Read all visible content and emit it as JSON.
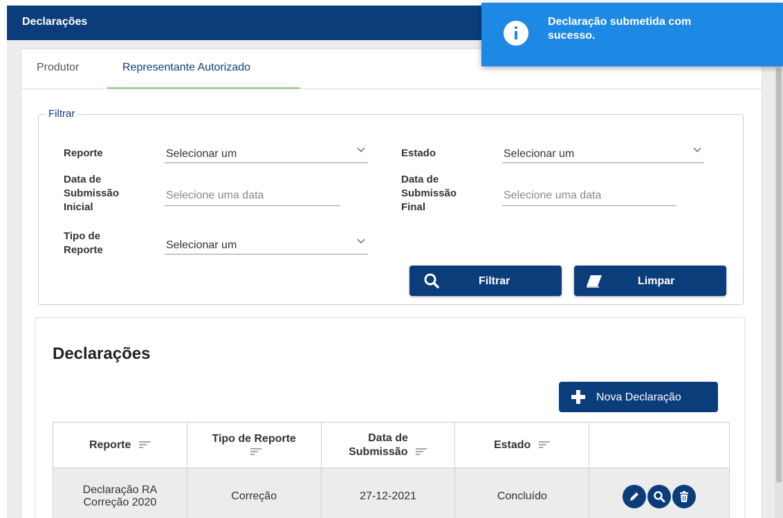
{
  "app": {
    "title": "Declarações"
  },
  "tabs": [
    {
      "label": "Produtor"
    },
    {
      "label": "Representante Autorizado"
    }
  ],
  "filter": {
    "legend": "Filtrar",
    "reporte": {
      "label": "Reporte",
      "value": "Selecionar um"
    },
    "estado": {
      "label": "Estado",
      "value": "Selecionar um"
    },
    "data_inicial": {
      "label_lines": [
        "Data de",
        "Submissão",
        "Inicial"
      ],
      "placeholder": "Selecione uma data"
    },
    "data_final": {
      "label_lines": [
        "Data de",
        "Submissão",
        "Final"
      ],
      "placeholder": "Selecione uma data"
    },
    "tipo_reporte": {
      "label_lines": [
        "Tipo de",
        "Reporte"
      ],
      "value": "Selecionar um"
    },
    "filtrar_label": "Filtrar",
    "limpar_label": "Limpar"
  },
  "list": {
    "title": "Declarações",
    "new_button": "Nova Declaração",
    "columns": [
      {
        "lines": [
          "Reporte"
        ]
      },
      {
        "lines": [
          "Tipo de Reporte"
        ]
      },
      {
        "lines": [
          "Data de",
          "Submissão"
        ]
      },
      {
        "lines": [
          "Estado"
        ]
      },
      {
        "lines": [
          ""
        ]
      }
    ],
    "rows": [
      {
        "reporte_lines": [
          "Declaração RA",
          "Correção 2020"
        ],
        "tipo": "Correção",
        "data": "27-12-2021",
        "estado": "Concluído"
      }
    ]
  },
  "toast": {
    "message_lines": [
      "Declaração submetida com",
      "sucesso."
    ],
    "icon": "info-icon"
  },
  "colors": {
    "primary": "#0b3d7a",
    "toast": "#1e88e5",
    "row_bg": "#ececec"
  }
}
